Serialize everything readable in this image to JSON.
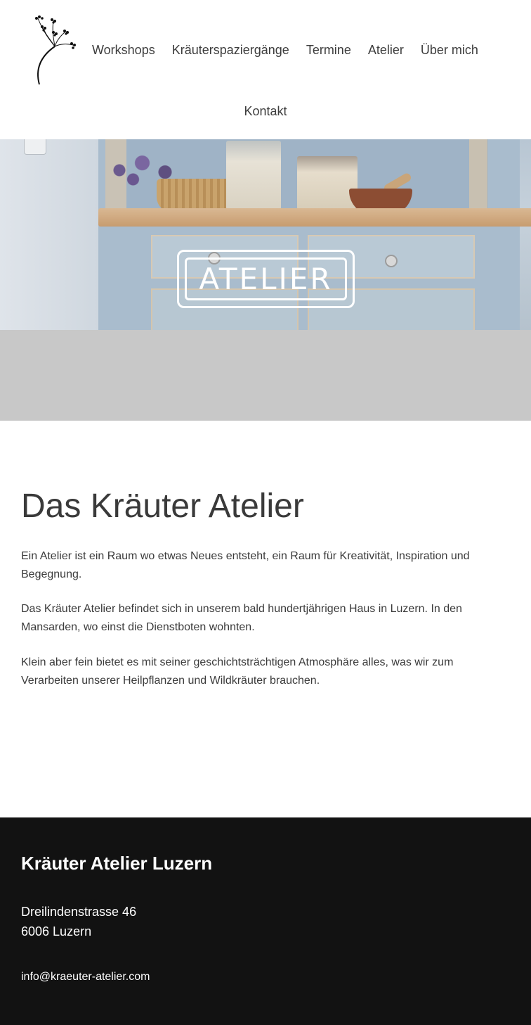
{
  "header": {
    "nav": [
      {
        "label": "Workshops"
      },
      {
        "label": "Kräuterspaziergänge"
      },
      {
        "label": "Termine"
      },
      {
        "label": "Atelier"
      },
      {
        "label": "Über mich"
      }
    ],
    "contact_label": "Kontakt"
  },
  "hero": {
    "title": "ATELIER"
  },
  "main": {
    "title": "Das Kräuter Atelier",
    "paragraphs": [
      "Ein Atelier ist ein Raum wo etwas Neues entsteht, ein Raum für Kreativität, Inspiration und Begegnung.",
      "Das Kräuter Atelier befindet sich in unserem bald hundertjährigen Haus in Luzern. In den Mansarden, wo einst die Dienstboten wohnten.",
      "Klein aber fein bietet es mit seiner geschichtsträchtigen Atmosphäre alles, was wir zum Verarbeiten unserer Heilpflanzen und Wildkräuter brauchen."
    ]
  },
  "footer": {
    "title": "Kräuter Atelier Luzern",
    "street": "Dreilindenstrasse 46",
    "city": "6006 Luzern",
    "email": "info@kraeuter-atelier.com"
  },
  "colors": {
    "footer_bg": "#121212",
    "band_grey": "#c8c8c8",
    "text": "#3a3a3a"
  }
}
